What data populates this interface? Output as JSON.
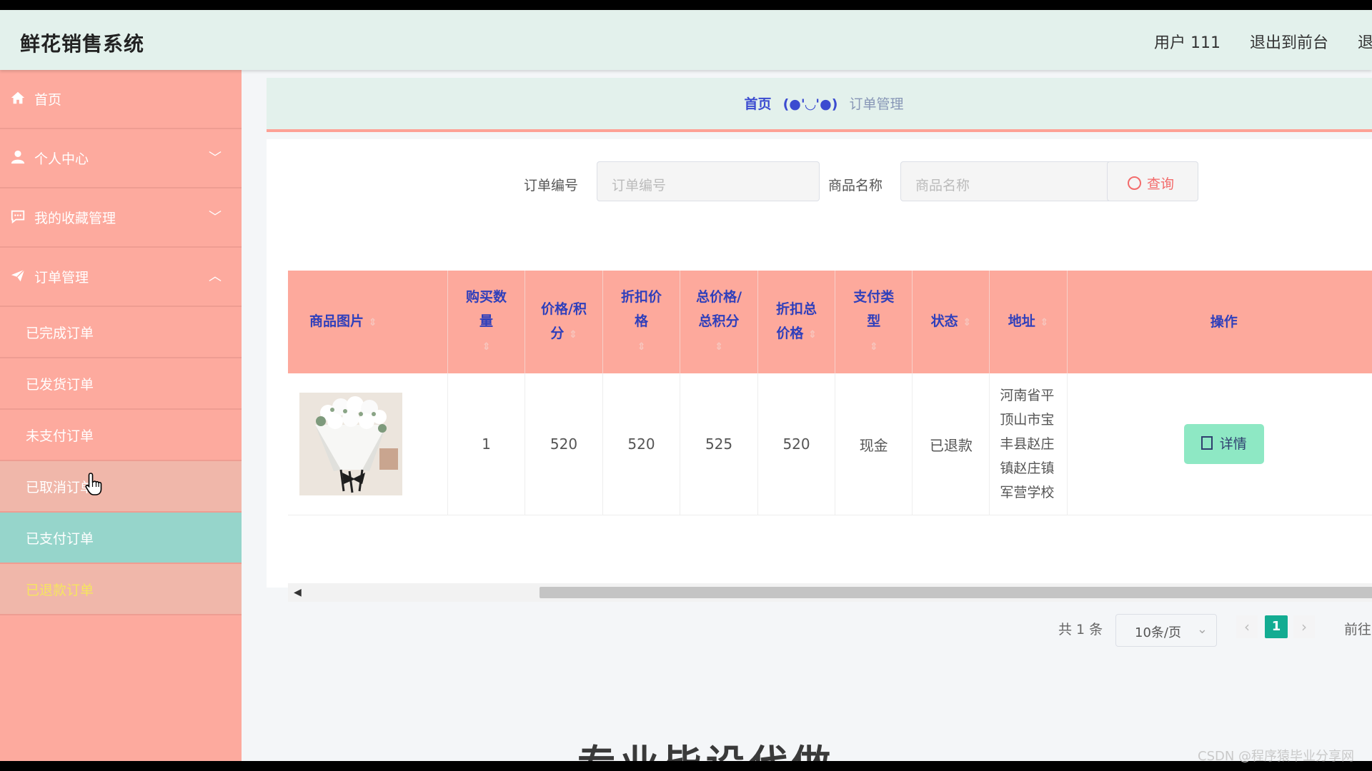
{
  "header": {
    "title": "鲜花销售系统",
    "user": "用户 111",
    "to_front": "退出到前台",
    "logout": "退出"
  },
  "sidebar": {
    "items": [
      {
        "label": "首页",
        "icon": "home-icon"
      },
      {
        "label": "个人中心",
        "icon": "user-icon"
      },
      {
        "label": "我的收藏管理",
        "icon": "chat-icon"
      },
      {
        "label": "订单管理",
        "icon": "paper-plane-icon"
      }
    ],
    "orders_submenu": [
      "已完成订单",
      "已发货订单",
      "未支付订单",
      "已取消订单",
      "已支付订单",
      "已退款订单"
    ]
  },
  "breadcrumb": {
    "home": "首页",
    "face": "(●'◡'●)",
    "current": "订单管理"
  },
  "search": {
    "order_no_label": "订单编号",
    "order_no_placeholder": "订单编号",
    "product_label": "商品名称",
    "product_placeholder": "商品名称",
    "query_button": "查询"
  },
  "table": {
    "headers": [
      "商品图片",
      "购买数量",
      "价格/积分",
      "折扣价格",
      "总价格/总积分",
      "折扣总价格",
      "支付类型",
      "状态",
      "地址",
      "操作"
    ],
    "rows": [
      {
        "quantity": "1",
        "price": "520",
        "discount_price": "520",
        "total": "525",
        "discount_total": "520",
        "pay_type": "现金",
        "status": "已退款",
        "address": "河南省平顶山市宝丰县赵庄镇赵庄镇军营学校",
        "action": "详情"
      }
    ]
  },
  "pagination": {
    "total": "共 1 条",
    "page_size": "10条/页",
    "current_page": "1",
    "goto": "前往"
  },
  "overlay": {
    "video_caption": "专业毕设代做",
    "watermark": "CSDN @程序猿毕业分享网"
  },
  "colors": {
    "sidebar_bg": "#fdaa9e",
    "header_bg": "#e3f1ec",
    "active_item": "#96d5cb",
    "current_item_text": "#f6e55f",
    "table_header": "#fda99c",
    "detail_button": "#8ee8c4",
    "page_active": "#13ac92"
  }
}
